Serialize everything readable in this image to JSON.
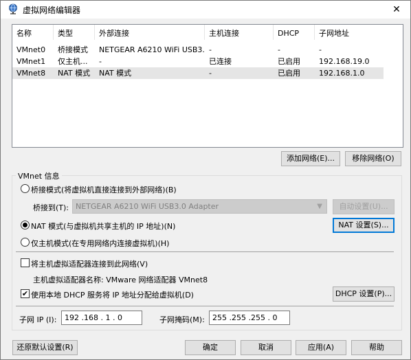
{
  "window": {
    "title": "虚拟网络编辑器",
    "close_glyph": "✕"
  },
  "table": {
    "headers": [
      "名称",
      "类型",
      "外部连接",
      "主机连接",
      "DHCP",
      "子网地址"
    ],
    "rows": [
      [
        "VMnet0",
        "桥接模式",
        "NETGEAR A6210 WiFi USB3....",
        "-",
        "-",
        "-"
      ],
      [
        "VMnet1",
        "仅主机...",
        "-",
        "已连接",
        "已启用",
        "192.168.19.0"
      ],
      [
        "VMnet8",
        "NAT 模式",
        "NAT 模式",
        "-",
        "已启用",
        "192.168.1.0"
      ]
    ]
  },
  "buttons": {
    "add_network": "添加网络(E)...",
    "remove_network": "移除网络(O)",
    "auto_settings": "自动设置(U)...",
    "nat_settings": "NAT 设置(S)...",
    "dhcp_settings": "DHCP 设置(P)...",
    "restore_defaults": "还原默认设置(R)",
    "ok": "确定",
    "cancel": "取消",
    "apply": "应用(A)",
    "help": "帮助"
  },
  "vmnet_info": {
    "group_label": "VMnet 信息",
    "bridge_mode": "桥接模式(将虚拟机直接连接到外部网络)(B)",
    "bridge_to_label": "桥接到(T):",
    "bridge_to_value": "NETGEAR A6210 WiFi USB3.0 Adapter",
    "nat_mode": "NAT 模式(与虚拟机共享主机的 IP 地址)(N)",
    "host_only_mode": "仅主机模式(在专用网络内连接虚拟机)(H)",
    "connect_adapter": "将主机虚拟适配器连接到此网络(V)",
    "adapter_name": "主机虚拟适配器名称: VMware 网络适配器 VMnet8",
    "use_dhcp": "使用本地 DHCP 服务将 IP 地址分配给虚拟机(D)",
    "subnet_ip_label": "子网 IP (I):",
    "subnet_ip_value": "192 .168 . 1 . 0",
    "subnet_mask_label": "子网掩码(M):",
    "subnet_mask_value": "255 .255 .255 . 0",
    "check_mark": "✔"
  }
}
